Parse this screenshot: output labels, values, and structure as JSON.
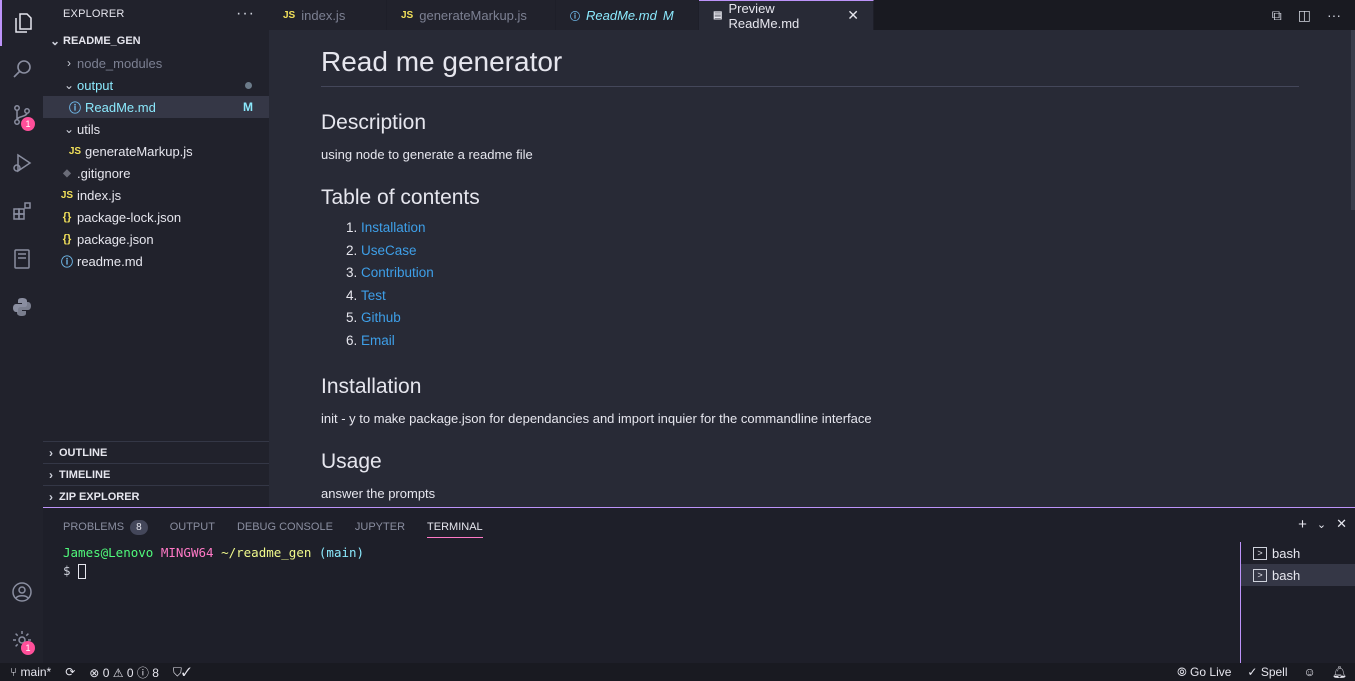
{
  "activity": {
    "scm_badge": "1",
    "settings_badge": "1"
  },
  "sidebar": {
    "title": "EXPLORER",
    "more": "···",
    "root": "README_GEN",
    "items": [
      {
        "label": "node_modules",
        "icon": "chevron-right",
        "kind": "folder"
      },
      {
        "label": "output",
        "icon": "chevron-down",
        "kind": "folder"
      },
      {
        "label": "ReadMe.md",
        "icon": "info",
        "status": "M"
      },
      {
        "label": "utils",
        "icon": "chevron-down",
        "kind": "folder"
      },
      {
        "label": "generateMarkup.js",
        "icon": "JS"
      },
      {
        "label": ".gitignore",
        "icon": "git"
      },
      {
        "label": "index.js",
        "icon": "JS"
      },
      {
        "label": "package-lock.json",
        "icon": "{ }"
      },
      {
        "label": "package.json",
        "icon": "{ }"
      },
      {
        "label": "readme.md",
        "icon": "info"
      }
    ],
    "sections": [
      "OUTLINE",
      "TIMELINE",
      "ZIP EXPLORER"
    ]
  },
  "tabs": [
    {
      "label": "index.js",
      "icon": "JS"
    },
    {
      "label": "generateMarkup.js",
      "icon": "JS"
    },
    {
      "label": "ReadMe.md",
      "icon": "ⓘ",
      "status": "M"
    },
    {
      "label": "Preview ReadMe.md",
      "icon": "preview"
    }
  ],
  "preview": {
    "title": "Read me generator",
    "description_heading": "Description",
    "description_text": "using node to generate a readme file",
    "toc_heading": "Table of contents",
    "toc": [
      "Installation",
      "UseCase",
      "Contribution",
      "Test",
      "Github",
      "Email"
    ],
    "installation_heading": "Installation",
    "installation_text": "init - y to make package.json for dependancies and import inquier for the commandline interface",
    "usage_heading": "Usage",
    "usage_text": "answer the prompts"
  },
  "panel": {
    "tabs": [
      "PROBLEMS",
      "OUTPUT",
      "DEBUG CONSOLE",
      "JUPYTER",
      "TERMINAL"
    ],
    "problems_count": "8",
    "terminal": {
      "user": "James@Lenovo",
      "host": "MINGW64",
      "path": "~/readme_gen",
      "branch": "(main)",
      "prompt": "$"
    },
    "terminals": [
      "bash",
      "bash"
    ]
  },
  "statusbar": {
    "branch": "main*",
    "errors": "0",
    "warnings": "0",
    "info": "8",
    "golive": "Go Live",
    "spell": "Spell"
  },
  "colors": {
    "accent": "#bd93f9",
    "link": "#3e9fe8",
    "badge": "#ff4f9a"
  }
}
